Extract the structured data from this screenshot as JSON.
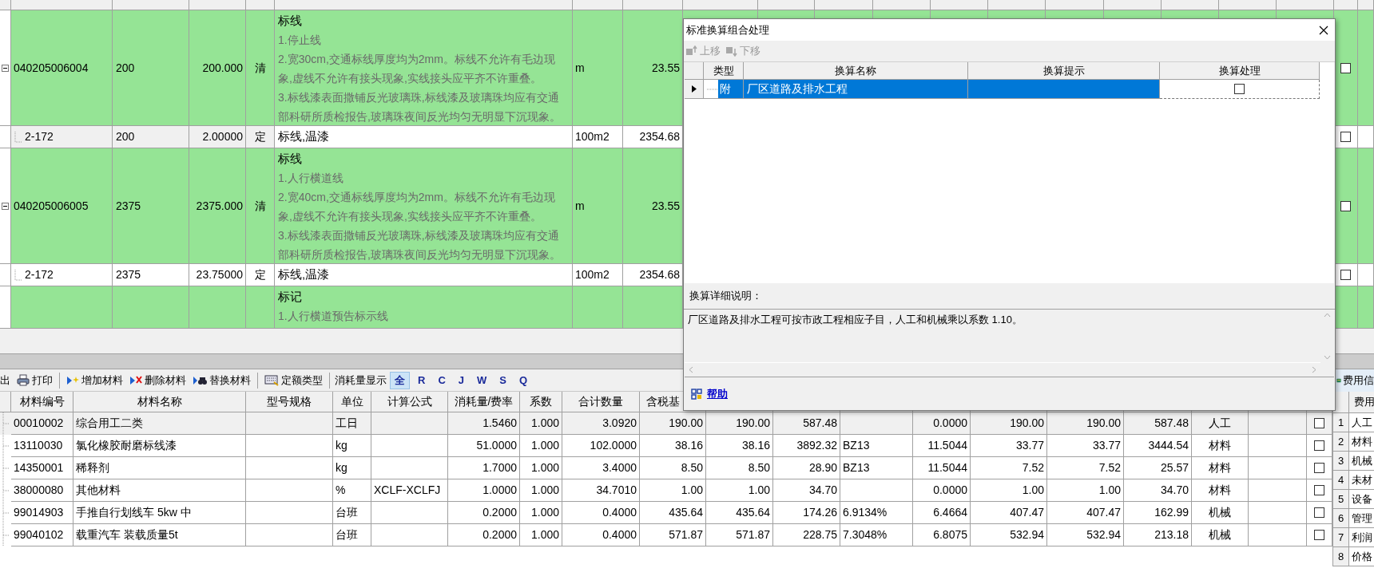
{
  "main_table": {
    "rows": [
      {
        "kind": "bill",
        "expanded": true,
        "code": "040205006004",
        "expr": "200",
        "qty": "200.000",
        "type": "清",
        "title": "标线",
        "description": [
          "1.停止线",
          "2.宽30cm,交通标线厚度均为2mm。标线不允许有毛边现象,虚线不允许有接头现象,实线接头应平齐不许重叠。",
          "3.标线漆表面撒铺反光玻璃珠,标线漆及玻璃珠均应有交通部科研所质检报告,玻璃珠夜间反光均匀无明显下沉现象。"
        ],
        "unit": "m",
        "price": "23.55",
        "checked": false
      },
      {
        "kind": "norm",
        "selected": true,
        "code": "2-172",
        "expr": "200",
        "qty": "2.00000",
        "type": "定",
        "title": "标线,温漆",
        "unit": "100m2",
        "price": "2354.68",
        "checked": false
      },
      {
        "kind": "bill",
        "expanded": true,
        "code": "040205006005",
        "expr": "2375",
        "qty": "2375.000",
        "type": "清",
        "title": "标线",
        "description": [
          "1.人行横道线",
          "2.宽40cm,交通标线厚度均为2mm。标线不允许有毛边现象,虚线不允许有接头现象,实线接头应平齐不许重叠。",
          "3.标线漆表面撒铺反光玻璃珠,标线漆及玻璃珠均应有交通部科研所质检报告,玻璃珠夜间反光均匀无明显下沉现象。"
        ],
        "unit": "m",
        "price": "23.55",
        "checked": false
      },
      {
        "kind": "norm",
        "selected": false,
        "code": "2-172",
        "expr": "2375",
        "qty": "23.75000",
        "type": "定",
        "title": "标线,温漆",
        "unit": "100m2",
        "price": "2354.68",
        "checked": false
      },
      {
        "kind": "bill",
        "title": "标记",
        "description": [
          "1.人行横道预告标示线"
        ]
      }
    ]
  },
  "toolbar": [
    {
      "kind": "export",
      "label": "出"
    },
    {
      "kind": "print",
      "label": "打印"
    },
    {
      "kind": "separator"
    },
    {
      "kind": "add",
      "label": "增加材料"
    },
    {
      "kind": "delete",
      "label": "删除材料"
    },
    {
      "kind": "replace",
      "label": "替换材料"
    },
    {
      "kind": "separator"
    },
    {
      "kind": "norm-type",
      "label": "定额类型"
    },
    {
      "kind": "separator"
    },
    {
      "kind": "label",
      "label": "消耗量显示"
    },
    {
      "kind": "filter",
      "label": "全",
      "selected": true
    },
    {
      "kind": "filter",
      "label": "R",
      "selected": false
    },
    {
      "kind": "filter",
      "label": "C",
      "selected": false
    },
    {
      "kind": "filter",
      "label": "J",
      "selected": false
    },
    {
      "kind": "filter",
      "label": "W",
      "selected": false
    },
    {
      "kind": "filter",
      "label": "S",
      "selected": false
    },
    {
      "kind": "filter",
      "label": "Q",
      "selected": false
    }
  ],
  "materials": {
    "columns": [
      "材料编号",
      "材料名称",
      "型号规格",
      "单位",
      "计算公式",
      "消耗量/费率",
      "系数",
      "合计数量",
      "含税基"
    ],
    "rows": [
      {
        "selected": true,
        "code": "00010002",
        "name": "综合用工二类",
        "unit": "工日",
        "consumption": "1.5460",
        "coefficient": "1.000",
        "total": "3.0920",
        "base_price": "190.00",
        "column_11": "190.00",
        "column_12": "587.48",
        "column_14": "0.0000",
        "column_15": "190.00",
        "column_16": "190.00",
        "column_17": "587.48",
        "column_18": "人工",
        "checked": false
      },
      {
        "selected": false,
        "code": "13110030",
        "name": "氯化橡胶耐磨标线漆",
        "unit": "kg",
        "consumption": "51.0000",
        "coefficient": "1.000",
        "total": "102.0000",
        "base_price": "38.16",
        "column_11": "38.16",
        "column_12": "3892.32",
        "column_13": "BZ13",
        "column_14": "11.5044",
        "column_15": "33.77",
        "column_16": "33.77",
        "column_17": "3444.54",
        "column_18": "材料",
        "checked": false
      },
      {
        "selected": false,
        "code": "14350001",
        "name": "稀释剂",
        "unit": "kg",
        "consumption": "1.7000",
        "coefficient": "1.000",
        "total": "3.4000",
        "base_price": "8.50",
        "column_11": "8.50",
        "column_12": "28.90",
        "column_13": "BZ13",
        "column_14": "11.5044",
        "column_15": "7.52",
        "column_16": "7.52",
        "column_17": "25.57",
        "column_18": "材料",
        "checked": false
      },
      {
        "selected": false,
        "code": "38000080",
        "name": "其他材料",
        "unit": "%",
        "formula": "XCLF-XCLFJ",
        "consumption": "1.0000",
        "coefficient": "1.000",
        "total": "34.7010",
        "base_price": "1.00",
        "column_11": "1.00",
        "column_12": "34.70",
        "column_14": "0.0000",
        "column_15": "1.00",
        "column_16": "1.00",
        "column_17": "34.70",
        "column_18": "材料",
        "checked": false
      },
      {
        "selected": false,
        "code": "99014903",
        "name": "手推自行划线车 5kw 中",
        "unit": "台班",
        "consumption": "0.2000",
        "coefficient": "1.000",
        "total": "0.4000",
        "base_price": "435.64",
        "column_11": "435.64",
        "column_12": "174.26",
        "column_13": "6.9134%",
        "column_14": "6.4664",
        "column_15": "407.47",
        "column_16": "407.47",
        "column_17": "162.99",
        "column_18": "机械",
        "checked": false
      },
      {
        "selected": false,
        "code": "99040102",
        "name": "载重汽车 装载质量5t",
        "unit": "台班",
        "consumption": "0.2000",
        "coefficient": "1.000",
        "total": "0.4000",
        "base_price": "571.87",
        "column_11": "571.87",
        "column_12": "228.75",
        "column_13": "7.3048%",
        "column_14": "6.8075",
        "column_15": "532.94",
        "column_16": "532.94",
        "column_17": "213.18",
        "column_18": "机械",
        "checked": false
      }
    ]
  },
  "fee_panel": {
    "title": "费用信",
    "header": "费用",
    "rows": [
      {
        "number": "1",
        "name": "人工"
      },
      {
        "number": "2",
        "name": "材料"
      },
      {
        "number": "3",
        "name": "机械"
      },
      {
        "number": "4",
        "name": "未材"
      },
      {
        "number": "5",
        "name": "设备"
      },
      {
        "number": "6",
        "name": "管理"
      },
      {
        "number": "7",
        "name": "利润"
      },
      {
        "number": "8",
        "name": "价格"
      }
    ]
  },
  "dialog": {
    "title": "标准换算组合处理",
    "toolbar": [
      {
        "kind": "up",
        "label": "上移",
        "disabled": true
      },
      {
        "kind": "down",
        "label": "下移",
        "disabled": true
      }
    ],
    "columns": [
      "类型",
      "换算名称",
      "换算提示",
      "换算处理"
    ],
    "rows": [
      {
        "type": "附",
        "name": "厂区道路及排水工程",
        "selected": true,
        "checked": false
      }
    ],
    "detail_label": "换算详细说明：",
    "detail_text": "厂区道路及排水工程可按市政工程相应子目，人工和机械乘以系数 1.10。",
    "help": "帮助"
  }
}
